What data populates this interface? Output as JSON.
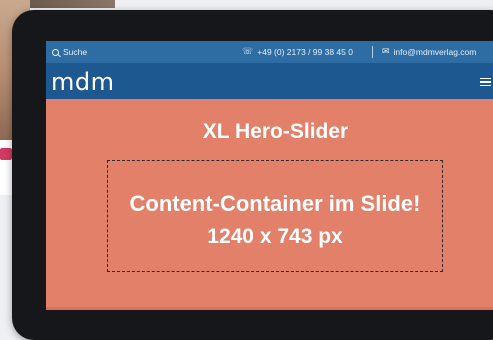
{
  "topbar": {
    "search_label": "Suche",
    "phone": "+49 (0) 2173 / 99 38 45 0",
    "email": "info@mdmverlag.com"
  },
  "header": {
    "logo_text": "mdm"
  },
  "hero": {
    "title": "XL Hero-Slider",
    "content_line1": "Content-Container im Slide!",
    "content_line2": "1240 x 743 px"
  },
  "colors": {
    "topbar": "#2e6da4",
    "header": "#1d5891",
    "hero_bg": "#e2806a",
    "tablet_frame": "#15171a"
  },
  "icons": {
    "search": "search-icon",
    "phone": "phone-icon",
    "email": "mail-icon",
    "menu": "hamburger-menu-icon"
  }
}
